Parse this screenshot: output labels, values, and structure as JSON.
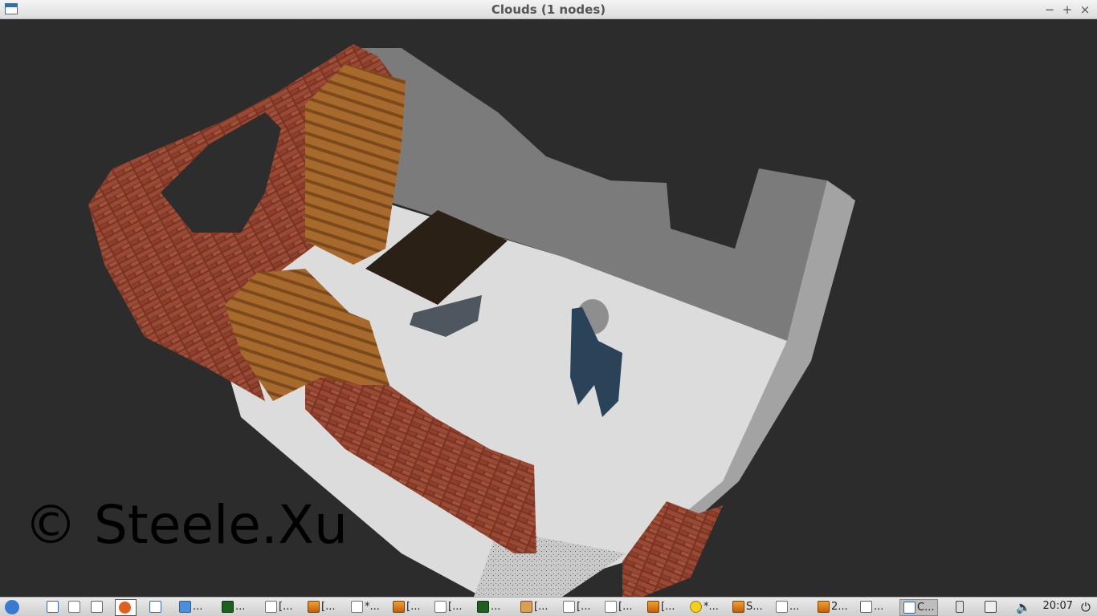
{
  "window": {
    "title": "Clouds (1 nodes)",
    "minimize": "−",
    "maximize": "+",
    "close": "×"
  },
  "watermark": "© Steele.Xu",
  "taskbar": {
    "tasks": [
      {
        "icon": "terminal-icon",
        "label": "..."
      },
      {
        "icon": "document-icon",
        "label": "[..."
      },
      {
        "icon": "image-icon",
        "label": "[..."
      },
      {
        "icon": "document-icon",
        "label": "*..."
      },
      {
        "icon": "image-icon",
        "label": "[..."
      },
      {
        "icon": "document-icon",
        "label": "[..."
      },
      {
        "icon": "terminal-icon",
        "label": "..."
      },
      {
        "icon": "package-icon",
        "label": "[..."
      },
      {
        "icon": "document-icon",
        "label": "[..."
      },
      {
        "icon": "document-icon",
        "label": "[..."
      },
      {
        "icon": "image-icon",
        "label": "[..."
      },
      {
        "icon": "smiley-icon",
        "label": "*..."
      },
      {
        "icon": "image-icon",
        "label": "S..."
      },
      {
        "icon": "document-icon",
        "label": "..."
      },
      {
        "icon": "image-icon",
        "label": "2..."
      },
      {
        "icon": "window-icon",
        "label": "..."
      },
      {
        "icon": "window-icon",
        "label": "C..."
      }
    ],
    "clock": "20:07"
  }
}
